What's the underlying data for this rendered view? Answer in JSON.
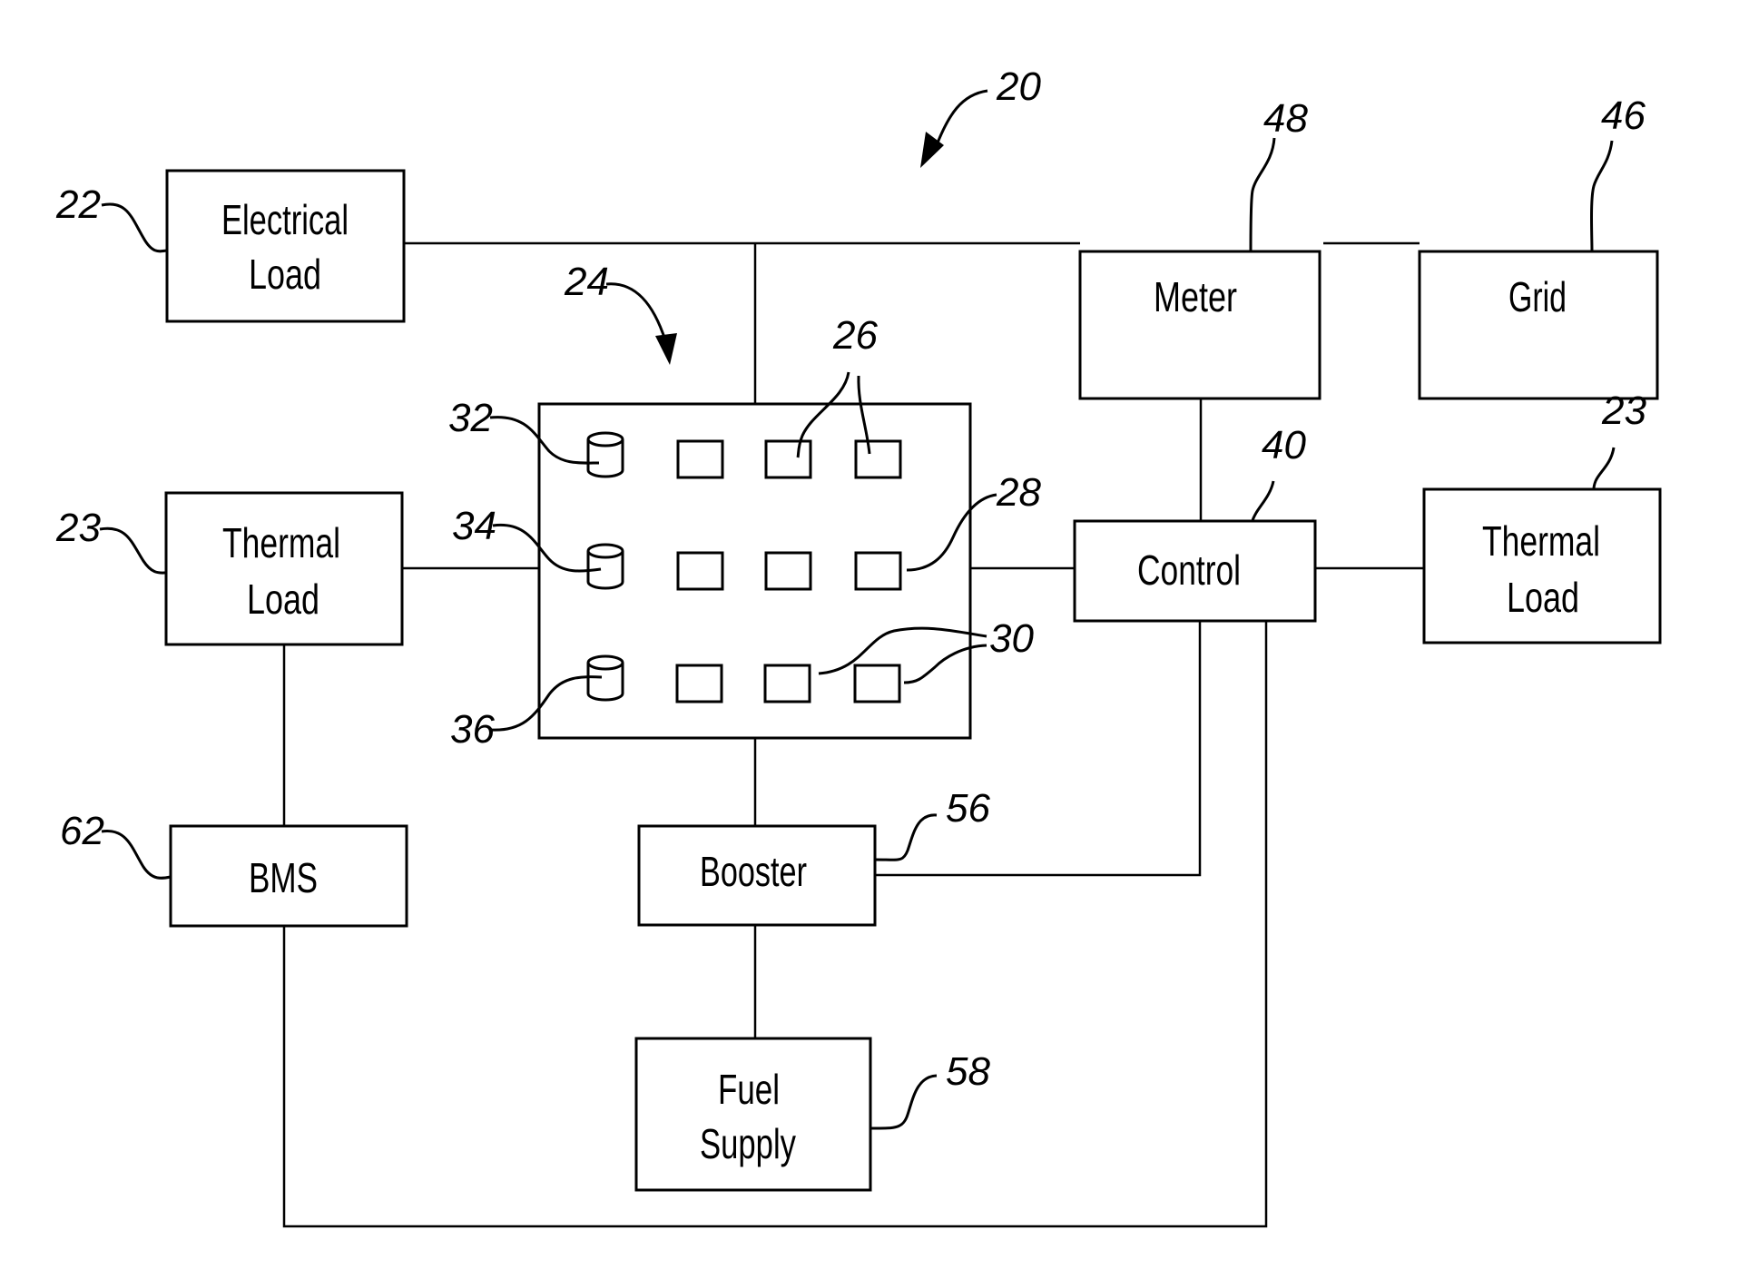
{
  "figure": {
    "system_ref": "20",
    "blocks": {
      "electrical_load": {
        "line1": "Electrical",
        "line2": "Load",
        "ref": "22"
      },
      "thermal_load_left": {
        "line1": "Thermal",
        "line2": "Load",
        "ref": "23"
      },
      "bms": {
        "label": "BMS",
        "ref": "62"
      },
      "stack_array": {
        "ref": "24"
      },
      "booster": {
        "label": "Booster",
        "ref": "56"
      },
      "fuel_supply": {
        "line1": "Fuel",
        "line2": "Supply",
        "ref": "58"
      },
      "meter": {
        "label": "Meter",
        "ref": "48"
      },
      "grid": {
        "label": "Grid",
        "ref": "46"
      },
      "control": {
        "label": "Control",
        "ref": "40"
      },
      "thermal_load_right": {
        "line1": "Thermal",
        "line2": "Load",
        "ref": "23"
      }
    },
    "array_refs": {
      "cylinder_top": "32",
      "cylinder_mid": "34",
      "cylinder_bottom": "36",
      "cells_top": "26",
      "cell_mid_right": "28",
      "cells_bottom": "30"
    }
  }
}
